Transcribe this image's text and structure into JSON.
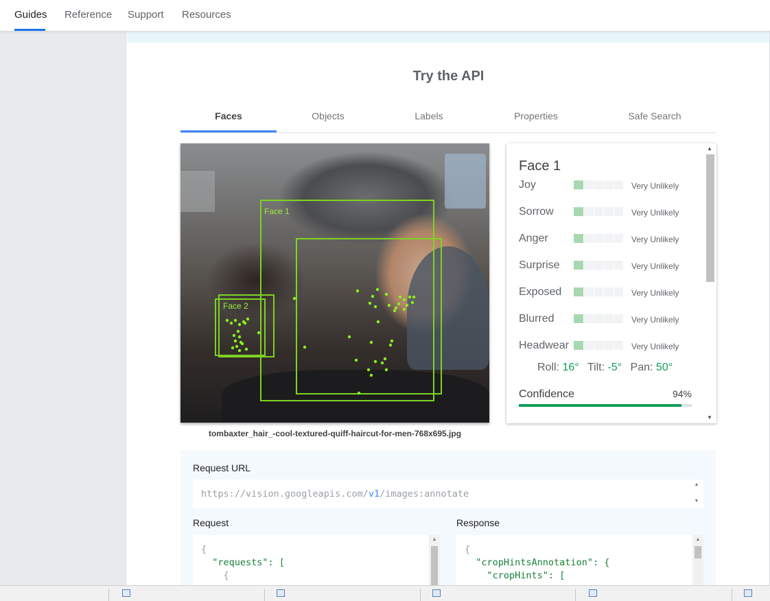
{
  "nav": {
    "items": [
      "Guides",
      "Reference",
      "Support",
      "Resources"
    ],
    "active": "Guides"
  },
  "title": "Try the API",
  "tabs": [
    "Faces",
    "Objects",
    "Labels",
    "Properties",
    "Safe Search"
  ],
  "image": {
    "caption": "tombaxter_hair_-cool-textured-quiff-haircut-for-men-768x695.jpg",
    "face_labels": [
      "Face 1",
      "Face 2"
    ]
  },
  "face_card": {
    "title": "Face 1",
    "emotions": [
      {
        "label": "Joy",
        "likelihood": "Very Unlikely",
        "level": 1
      },
      {
        "label": "Sorrow",
        "likelihood": "Very Unlikely",
        "level": 1
      },
      {
        "label": "Anger",
        "likelihood": "Very Unlikely",
        "level": 1
      },
      {
        "label": "Surprise",
        "likelihood": "Very Unlikely",
        "level": 1
      },
      {
        "label": "Exposed",
        "likelihood": "Very Unlikely",
        "level": 1
      },
      {
        "label": "Blurred",
        "likelihood": "Very Unlikely",
        "level": 1
      },
      {
        "label": "Headwear",
        "likelihood": "Very Unlikely",
        "level": 1
      }
    ],
    "angles": {
      "roll_label": "Roll:",
      "roll": "16°",
      "tilt_label": "Tilt:",
      "tilt": "-5°",
      "pan_label": "Pan:",
      "pan": "50°"
    },
    "confidence_label": "Confidence",
    "confidence": "94%",
    "confidence_fraction": 0.94
  },
  "api": {
    "request_url_label": "Request URL",
    "url_prefix": "https://vision.googleapis.com/",
    "url_version": "v1",
    "url_suffix": "/images:annotate",
    "request_label": "Request",
    "response_label": "Response",
    "request_lines": [
      "{",
      "\"requests\": [",
      "{"
    ],
    "response_lines": [
      "{",
      "\"cropHintsAnnotation\": {",
      "\"cropHints\": ["
    ]
  },
  "colors": {
    "accent": "#1a73e8",
    "tab_indicator": "#4285f4",
    "green": "#0f9d58",
    "face_box": "#7ed321"
  }
}
